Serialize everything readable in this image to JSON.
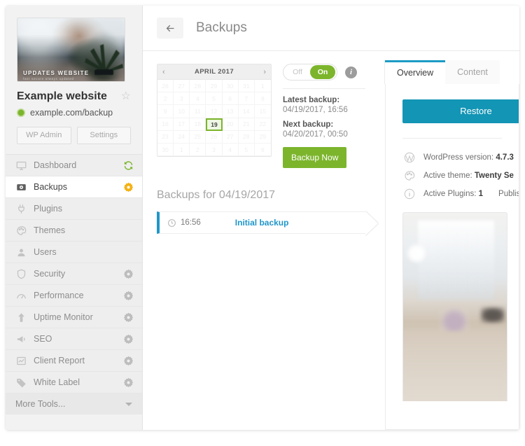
{
  "sidebar": {
    "site": {
      "thumb_caption": "UPDATES WEBSITE",
      "thumb_subcaption": "fast  secure  always updated",
      "name": "Example website",
      "star_icon": "star-icon",
      "url": "example.com/backup",
      "status_color": "#7cb52c",
      "buttons": [
        {
          "label": "WP Admin",
          "name": "wp-admin-button"
        },
        {
          "label": "Settings",
          "name": "settings-button"
        }
      ]
    },
    "nav": [
      {
        "label": "Dashboard",
        "icon": "monitor-icon",
        "right_icon": "sync-icon",
        "right_color": "#7cb52c",
        "active": false
      },
      {
        "label": "Backups",
        "icon": "hard-drive-icon",
        "right_icon": "gear-icon",
        "right_color": "#f5b115",
        "active": true
      },
      {
        "label": "Plugins",
        "icon": "plug-icon",
        "right_icon": "",
        "right_color": "",
        "active": false
      },
      {
        "label": "Themes",
        "icon": "palette-icon",
        "right_icon": "",
        "right_color": "",
        "active": false
      },
      {
        "label": "Users",
        "icon": "user-icon",
        "right_icon": "",
        "right_color": "",
        "active": false
      },
      {
        "label": "Security",
        "icon": "shield-icon",
        "right_icon": "gear-icon",
        "right_color": "#bdbdbd",
        "active": false
      },
      {
        "label": "Performance",
        "icon": "gauge-icon",
        "right_icon": "gear-icon",
        "right_color": "#bdbdbd",
        "active": false
      },
      {
        "label": "Uptime Monitor",
        "icon": "arrow-up-icon",
        "right_icon": "gear-icon",
        "right_color": "#bdbdbd",
        "active": false
      },
      {
        "label": "SEO",
        "icon": "megaphone-icon",
        "right_icon": "gear-icon",
        "right_color": "#bdbdbd",
        "active": false
      },
      {
        "label": "Client Report",
        "icon": "chart-icon",
        "right_icon": "gear-icon",
        "right_color": "#bdbdbd",
        "active": false
      },
      {
        "label": "White Label",
        "icon": "tag-icon",
        "right_icon": "gear-icon",
        "right_color": "#bdbdbd",
        "active": false
      }
    ],
    "more_tools": {
      "label": "More Tools...",
      "icon": "chevron-down-icon"
    }
  },
  "header": {
    "back_icon": "back-arrow-icon",
    "title": "Backups"
  },
  "calendar": {
    "prev_icon": "chevron-left-icon",
    "next_icon": "chevron-right-icon",
    "title": "APRIL 2017",
    "selected_day": "19",
    "weeks": [
      [
        "26",
        "27",
        "28",
        "29",
        "30",
        "31",
        "1"
      ],
      [
        "2",
        "3",
        "4",
        "5",
        "6",
        "7",
        "8"
      ],
      [
        "9",
        "10",
        "11",
        "12",
        "13",
        "14",
        "15"
      ],
      [
        "16",
        "17",
        "18",
        "19",
        "20",
        "21",
        "22"
      ],
      [
        "23",
        "24",
        "25",
        "26",
        "27",
        "28",
        "29"
      ],
      [
        "30",
        "1",
        "2",
        "3",
        "4",
        "5",
        "6"
      ]
    ]
  },
  "schedule": {
    "toggle": {
      "off_label": "Off",
      "on_label": "On",
      "state": "On",
      "on_color": "#7cb52c"
    },
    "info_icon": "info-icon",
    "latest_label": "Latest backup:",
    "latest_value": "04/19/2017, 16:56",
    "next_label": "Next backup:",
    "next_value": "04/20/2017, 00:50",
    "backup_now_label": "Backup Now"
  },
  "backups": {
    "list_title": "Backups for 04/19/2017",
    "items": [
      {
        "time": "16:56",
        "name": "Initial backup",
        "clock_icon": "clock-icon",
        "accent": "#2196c9"
      }
    ]
  },
  "detail": {
    "tabs": [
      {
        "label": "Overview",
        "active": true
      },
      {
        "label": "Content",
        "active": false
      }
    ],
    "restore_label": "Restore",
    "restore_color": "#1395b5",
    "meta": [
      {
        "icon": "wordpress-icon",
        "label": "WordPress version: ",
        "value": "4.7.3",
        "extra": ""
      },
      {
        "icon": "palette-icon",
        "label": "Active theme: ",
        "value": "Twenty Se",
        "extra": ""
      },
      {
        "icon": "info-icon",
        "label": "Active Plugins: ",
        "value": "1",
        "extra": "Publis"
      }
    ],
    "screenshot_name": "site-screenshot-thumbnail"
  }
}
